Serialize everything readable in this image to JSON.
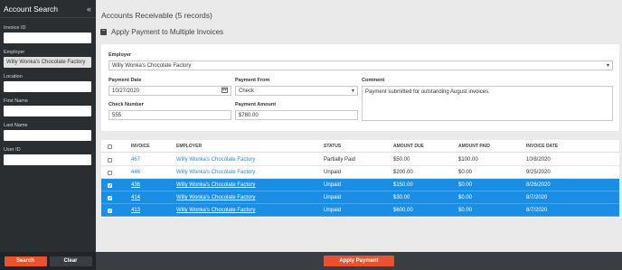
{
  "sidebar": {
    "title": "Account Search",
    "fields": [
      {
        "label": "Invoice ID",
        "value": ""
      },
      {
        "label": "Employer",
        "value": "Willy Wonka's Chocolate Factory"
      },
      {
        "label": "Location",
        "value": ""
      },
      {
        "label": "First Name",
        "value": ""
      },
      {
        "label": "Last Name",
        "value": ""
      },
      {
        "label": "User ID",
        "value": ""
      }
    ],
    "search_label": "Search",
    "clear_label": "Clear"
  },
  "main": {
    "title": "Accounts Receivable (5 records)",
    "section_title": "Apply Payment to Multiple Invoices",
    "form": {
      "employer_label": "Employer",
      "employer_value": "Willy Wonka's Chocolate Factory",
      "payment_date_label": "Payment Date",
      "payment_date_value": "10/27/2020",
      "payment_from_label": "Payment From",
      "payment_from_value": "Check",
      "comment_label": "Comment",
      "comment_value": "Payment submitted for outstanding August invoices.",
      "check_number_label": "Check Number",
      "check_number_value": "555",
      "payment_amount_label": "Payment Amount",
      "payment_amount_value": "$780.00"
    },
    "table": {
      "headers": [
        "INVOICE",
        "EMPLOYER",
        "STATUS",
        "AMOUNT DUE",
        "AMOUNT PAID",
        "INVOICE DATE"
      ],
      "rows": [
        {
          "invoice": "467",
          "employer": "Willy Wonka's Chocolate Factory",
          "status": "Partially Paid",
          "amount_due": "$50.00",
          "amount_paid": "$100.00",
          "date": "10/8/2020",
          "selected": false
        },
        {
          "invoice": "446",
          "employer": "Willy Wonka's Chocolate Factory",
          "status": "Unpaid",
          "amount_due": "$200.00",
          "amount_paid": "$0.00",
          "date": "9/25/2020",
          "selected": false
        },
        {
          "invoice": "436",
          "employer": "Willy Wonka's Chocolate Factory",
          "status": "Unpaid",
          "amount_due": "$150.00",
          "amount_paid": "$0.00",
          "date": "8/26/2020",
          "selected": true
        },
        {
          "invoice": "414",
          "employer": "Willy Wonka's Chocolate Factory",
          "status": "Unpaid",
          "amount_due": "$30.00",
          "amount_paid": "$0.00",
          "date": "8/7/2020",
          "selected": true
        },
        {
          "invoice": "413",
          "employer": "Willy Wonka's Chocolate Factory",
          "status": "Unpaid",
          "amount_due": "$600.00",
          "amount_paid": "$0.00",
          "date": "8/7/2020",
          "selected": true
        }
      ]
    },
    "apply_label": "Apply Payment"
  },
  "colors": {
    "accent": "#e8522c",
    "selected_row": "#1a8de4",
    "link": "#2a8ad6",
    "sidebar_bg": "#2b2e31"
  },
  "icons": {
    "collapse": "double-chevron-left-icon",
    "calendar": "calendar-icon",
    "dropdown": "caret-down-icon",
    "section_toggle": "minus-square-icon",
    "check": "checkmark-icon"
  }
}
